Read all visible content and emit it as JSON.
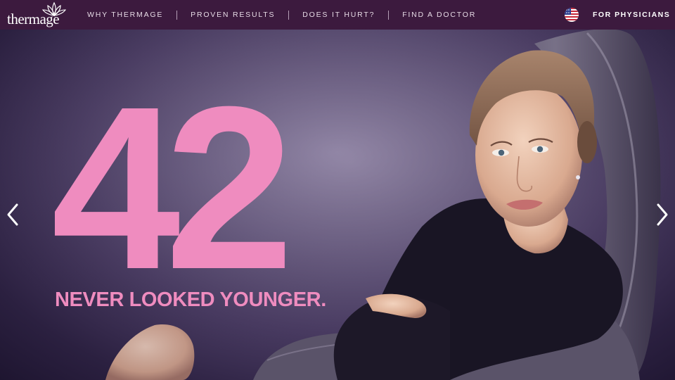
{
  "header": {
    "logo_text": "thermage",
    "nav": [
      "WHY THERMAGE",
      "PROVEN RESULTS",
      "DOES IT HURT?",
      "FIND A DOCTOR"
    ],
    "physicians_label": "FOR PHYSICIANS",
    "colors": {
      "bar": "#3c1a3e",
      "text": "#e7dbe6"
    }
  },
  "hero": {
    "age": "42",
    "tagline": "NEVER LOOKED YOUNGER.",
    "accent_color": "#ef8cbf"
  },
  "icons": [
    "lotus-logo-icon",
    "us-flag-icon",
    "chevron-left-icon",
    "chevron-right-icon"
  ]
}
